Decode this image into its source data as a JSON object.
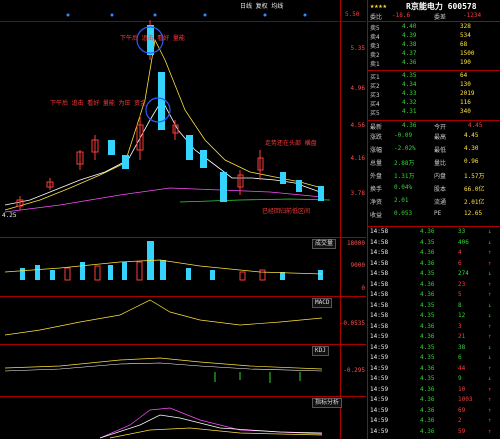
{
  "header": {
    "info": "日线 复权 均线",
    "axis_top": "5.50"
  },
  "price_axis": [
    "5.35",
    "4.96",
    "4.56",
    "4.16",
    "3.78"
  ],
  "notes": {
    "first_peak": "下午后 追击 看好 量能",
    "second_peak": "下午后 追击 看好 量能 为压 资金",
    "right": "走势还在头部 横盘",
    "bottom": "已经回归前低区间"
  },
  "dates": {
    "left": "4.25"
  },
  "panels": {
    "volume": {
      "label": "成交量",
      "ticks": [
        "18000",
        "9000",
        "0"
      ]
    },
    "macd": {
      "label": "MACD",
      "value": "-0.0535"
    },
    "kdj": {
      "label": "KDJ",
      "value": "-0.295"
    },
    "bottom": {
      "label": "指标分析"
    }
  },
  "sidebar": {
    "stars": "★★★★",
    "title": "R京能电力 600578",
    "order_header": [
      "委比",
      "-18.6",
      "委差",
      "-1234"
    ],
    "sells": [
      {
        "label": "卖5",
        "price": "4.40",
        "vol": "328"
      },
      {
        "label": "卖4",
        "price": "4.39",
        "vol": "534"
      },
      {
        "label": "卖3",
        "price": "4.38",
        "vol": "68"
      },
      {
        "label": "卖2",
        "price": "4.37",
        "vol": "1500"
      },
      {
        "label": "卖1",
        "price": "4.36",
        "vol": "190"
      }
    ],
    "buys": [
      {
        "label": "买1",
        "price": "4.35",
        "vol": "64"
      },
      {
        "label": "买2",
        "price": "4.34",
        "vol": "130"
      },
      {
        "label": "买3",
        "price": "4.33",
        "vol": "2019"
      },
      {
        "label": "买4",
        "price": "4.32",
        "vol": "116"
      },
      {
        "label": "买5",
        "price": "4.31",
        "vol": "340"
      }
    ],
    "stats_header": [
      "最新",
      "4.36",
      "今开",
      "4.45"
    ],
    "stats": [
      {
        "l": "涨跌",
        "v": "-0.09",
        "l2": "最高",
        "v2": "4.45"
      },
      {
        "l": "涨幅",
        "v": "-2.02%",
        "l2": "最低",
        "v2": "4.30"
      },
      {
        "l": "总量",
        "v": "2.88万",
        "l2": "量比",
        "v2": "0.96"
      },
      {
        "l": "外盘",
        "v": "1.31万",
        "l2": "内盘",
        "v2": "1.57万"
      },
      {
        "l": "换手",
        "v": "0.04%",
        "l2": "股本",
        "v2": "66.0亿"
      },
      {
        "l": "净资",
        "v": "2.01",
        "l2": "流通",
        "v2": "2.01亿"
      },
      {
        "l": "收益",
        "v": "0.053",
        "l2": "PE",
        "v2": "12.65"
      }
    ],
    "ticks": [
      {
        "t": "14:58",
        "p": "4.36",
        "v": "33",
        "d": "↓"
      },
      {
        "t": "14:58",
        "p": "4.35",
        "v": "406",
        "d": "↓"
      },
      {
        "t": "14:58",
        "p": "4.36",
        "v": "4",
        "d": "↑"
      },
      {
        "t": "14:58",
        "p": "4.36",
        "v": "6",
        "d": "↑"
      },
      {
        "t": "14:58",
        "p": "4.35",
        "v": "274",
        "d": "↓"
      },
      {
        "t": "14:58",
        "p": "4.36",
        "v": "23",
        "d": "↑"
      },
      {
        "t": "14:58",
        "p": "4.36",
        "v": "5",
        "d": "↑"
      },
      {
        "t": "14:58",
        "p": "4.35",
        "v": "8",
        "d": "↓"
      },
      {
        "t": "14:58",
        "p": "4.35",
        "v": "12",
        "d": "↓"
      },
      {
        "t": "14:58",
        "p": "4.36",
        "v": "3",
        "d": "↑"
      },
      {
        "t": "14:59",
        "p": "4.36",
        "v": "21",
        "d": "↑"
      },
      {
        "t": "14:59",
        "p": "4.35",
        "v": "38",
        "d": "↓"
      },
      {
        "t": "14:59",
        "p": "4.35",
        "v": "6",
        "d": "↓"
      },
      {
        "t": "14:59",
        "p": "4.36",
        "v": "44",
        "d": "↑"
      },
      {
        "t": "14:59",
        "p": "4.35",
        "v": "9",
        "d": "↓"
      },
      {
        "t": "14:59",
        "p": "4.36",
        "v": "10",
        "d": "↑"
      },
      {
        "t": "14:59",
        "p": "4.36",
        "v": "1003",
        "d": "↑"
      },
      {
        "t": "14:59",
        "p": "4.36",
        "v": "69",
        "d": "↑"
      },
      {
        "t": "14:59",
        "p": "4.36",
        "v": "2",
        "d": "↑"
      },
      {
        "t": "14:59",
        "p": "4.36",
        "v": "59",
        "d": "↑"
      }
    ]
  },
  "colors": {
    "up": "#ff3b3b",
    "down": "#35d4ff",
    "ma5": "#ffffff",
    "ma10": "#ffe23b",
    "ma20": "#ff4dff"
  }
}
